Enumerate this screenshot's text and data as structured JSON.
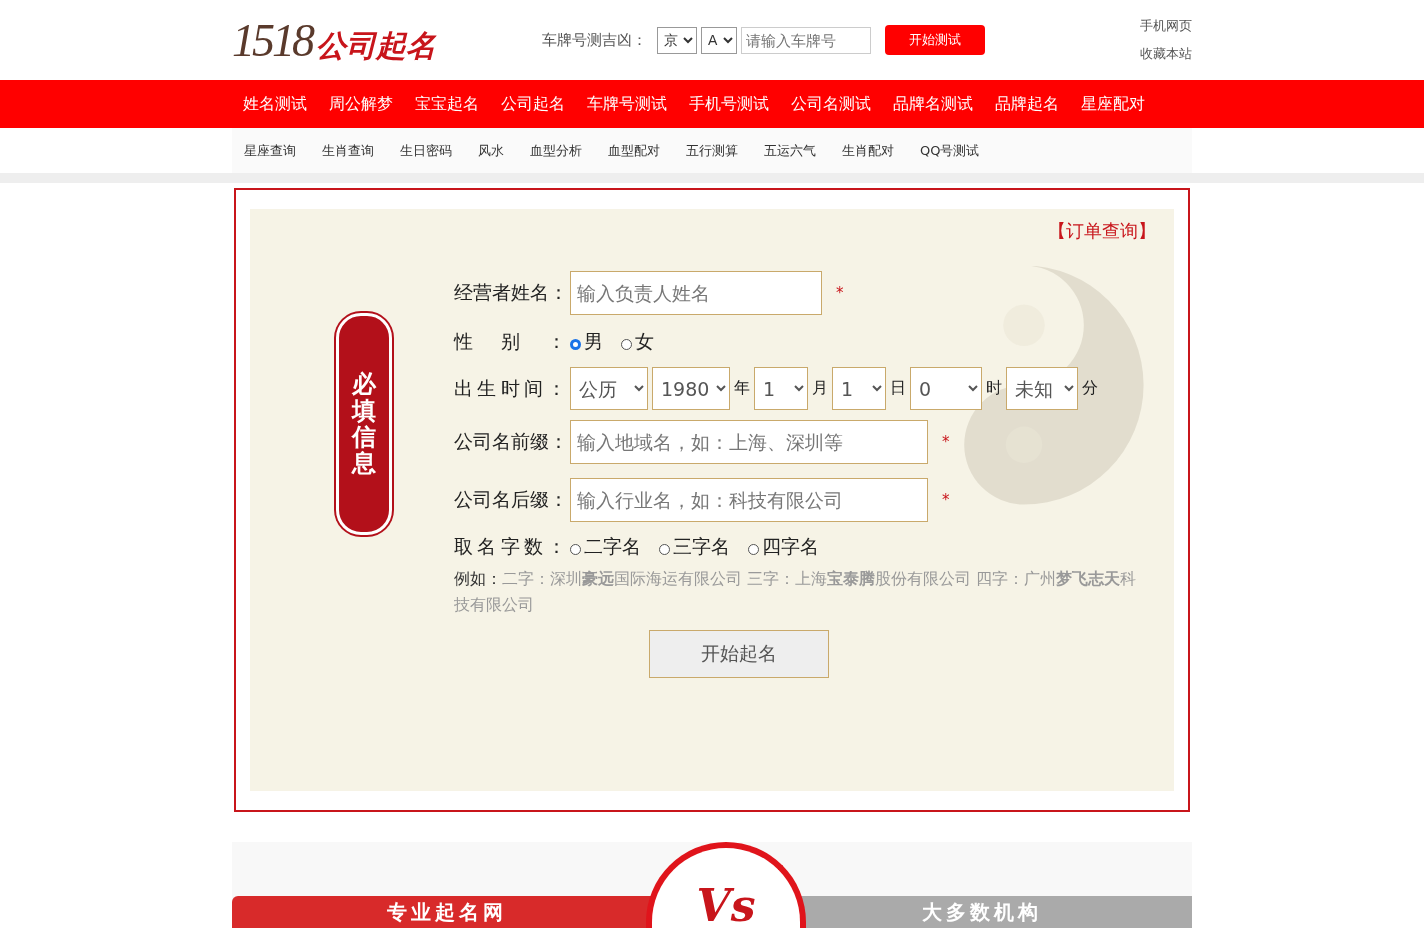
{
  "header": {
    "logo": {
      "number": "1518",
      "text": "公司起名"
    },
    "plate_search": {
      "label": "车牌号测吉凶：",
      "province": "京",
      "letter": "A",
      "placeholder": "请输入车牌号",
      "button": "开始测试"
    },
    "links": [
      "手机网页",
      "收藏本站"
    ]
  },
  "main_nav": [
    {
      "label": "姓名测试"
    },
    {
      "label": "周公解梦"
    },
    {
      "label": "宝宝起名"
    },
    {
      "label": "公司起名"
    },
    {
      "label": "车牌号测试"
    },
    {
      "label": "手机号测试"
    },
    {
      "label": "公司名测试"
    },
    {
      "label": "品牌名测试"
    },
    {
      "label": "品牌起名"
    },
    {
      "label": "星座配对"
    }
  ],
  "sub_nav": [
    {
      "label": "星座查询"
    },
    {
      "label": "生肖查询"
    },
    {
      "label": "生日密码"
    },
    {
      "label": "风水"
    },
    {
      "label": "血型分析"
    },
    {
      "label": "血型配对"
    },
    {
      "label": "五行测算"
    },
    {
      "label": "五运六气"
    },
    {
      "label": "生肖配对"
    },
    {
      "label": "QQ号测试"
    }
  ],
  "form": {
    "order_link": "【订单查询】",
    "badge": "必填信息",
    "owner": {
      "label": "经营者姓名：",
      "placeholder": "输入负责人姓名",
      "required": "*"
    },
    "gender": {
      "label": "性别：",
      "options": [
        {
          "label": "男",
          "selected": true
        },
        {
          "label": "女",
          "selected": false
        }
      ]
    },
    "birth": {
      "label": "出生时间：",
      "selects": [
        {
          "value": "公历"
        },
        {
          "value": "1980",
          "unit": "年"
        },
        {
          "value": "1",
          "unit": "月"
        },
        {
          "value": "1",
          "unit": "日"
        },
        {
          "value": "0",
          "unit": "时"
        },
        {
          "value": "未知",
          "unit": "分"
        }
      ]
    },
    "prefix": {
      "label": "公司名前缀：",
      "placeholder": "输入地域名，如：上海、深圳等",
      "required": "*"
    },
    "suffix": {
      "label": "公司名后缀：",
      "placeholder": "输入行业名，如：科技有限公司",
      "required": "*"
    },
    "word_count": {
      "label": "取名字数：",
      "options": [
        {
          "label": "二字名",
          "selected": false
        },
        {
          "label": "三字名",
          "selected": false
        },
        {
          "label": "四字名",
          "selected": false
        }
      ]
    },
    "example": {
      "label": "例如：",
      "text": "二字：深圳**豪远**国际海运有限公司  三字：上海**宝泰腾**股份有限公司  四字：广州**梦飞志天**科技有限公司"
    },
    "submit": "开始起名"
  },
  "banner": {
    "left": "专业起名网",
    "vs": "Vs",
    "right": "大多数机构"
  }
}
